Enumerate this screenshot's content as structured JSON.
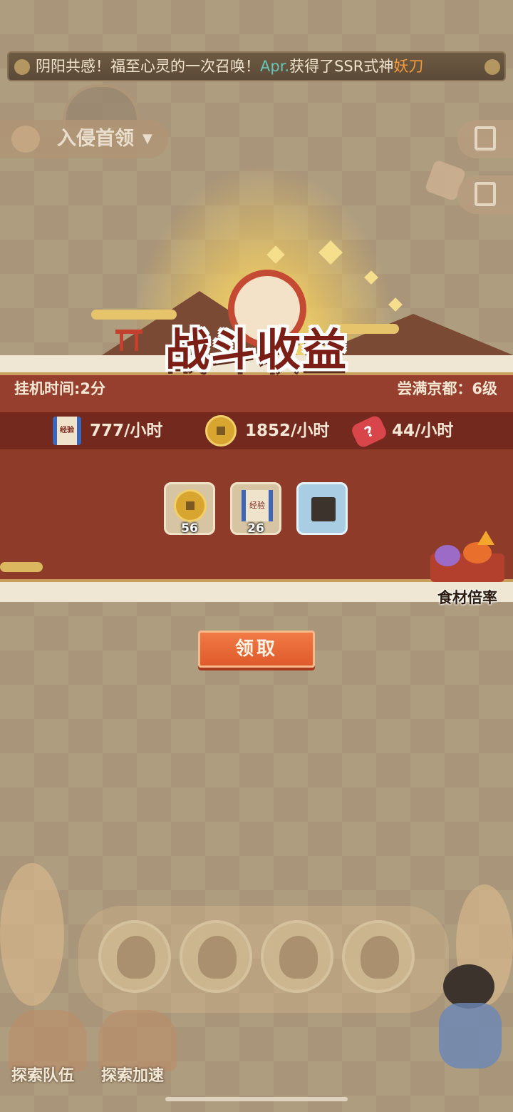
{
  "announcement": {
    "prefix": "阴阳共感！福至心灵的一次召唤！",
    "player": "Apr.",
    "middle": "获得了SSR式神",
    "reward": "妖刀"
  },
  "invade_dropdown": {
    "label": "入侵首领",
    "arrow": "▼"
  },
  "reward_panel": {
    "title": "战斗收益",
    "idle_time": "挂机时间:2分",
    "area": "尝满京都：6级",
    "rates": [
      {
        "icon": "exp-scroll-icon",
        "icon_text": "经验",
        "text": "777/小时"
      },
      {
        "icon": "coin-icon",
        "text": "1852/小时"
      },
      {
        "icon": "candy-ticket-icon",
        "icon_text": "?",
        "text": "44/小时"
      }
    ],
    "items": [
      {
        "icon": "coin-icon",
        "count": "56"
      },
      {
        "icon": "exp-scroll-icon",
        "icon_text": "经验",
        "count": "26"
      },
      {
        "icon": "seaweed-icon",
        "count": ""
      }
    ],
    "food_multiplier_label": "食材倍率"
  },
  "claim_button": {
    "label": "领取"
  },
  "bottom": {
    "team_label": "探索队伍",
    "speedup_label": "探索加速"
  }
}
